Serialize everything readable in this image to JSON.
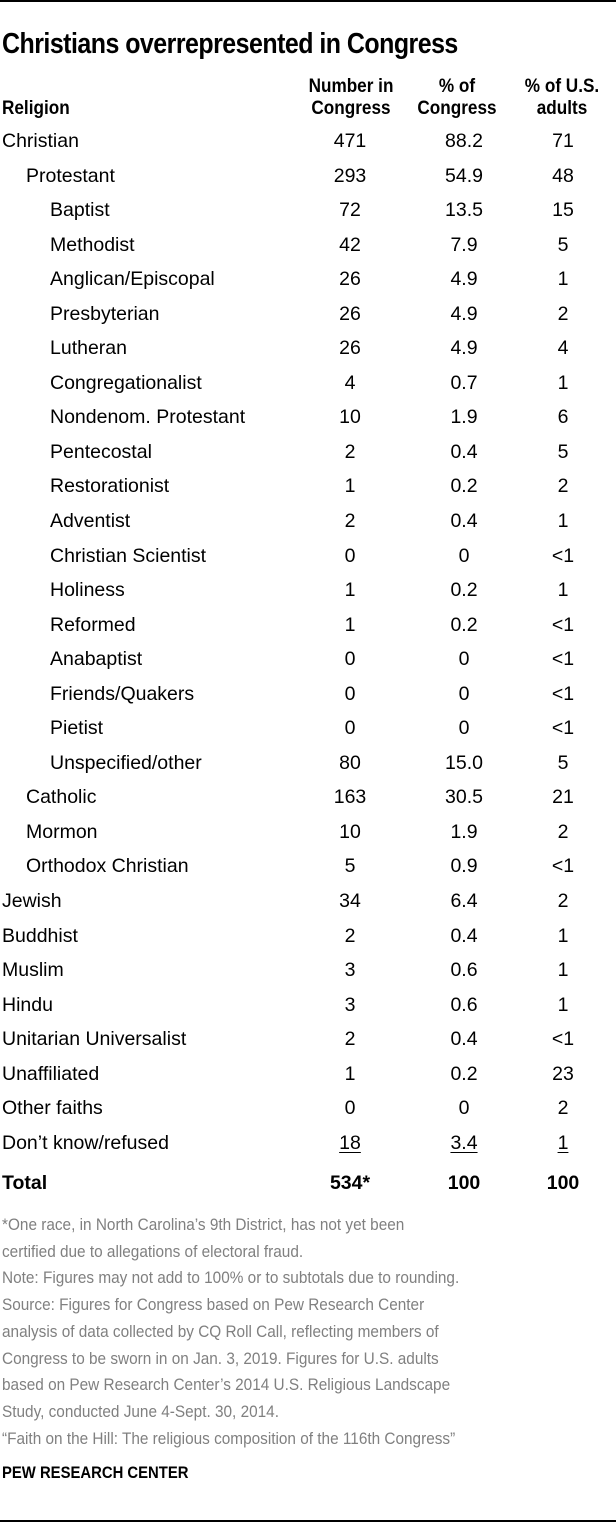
{
  "chart_data": {
    "type": "table",
    "title": "Christians overrepresented in Congress",
    "columns": [
      "Religion",
      "Number in Congress",
      "% of Congress",
      "% of U.S. adults"
    ],
    "column_headers": {
      "religion": "Religion",
      "number_line1": "Number in",
      "number_line2": "Congress",
      "pct_congress_line1": "% of",
      "pct_congress_line2": "Congress",
      "pct_us_line1": "% of U.S.",
      "pct_us_line2": "adults"
    },
    "rows": [
      {
        "religion": "Christian",
        "level": 0,
        "number": "471",
        "pct_congress": "88.2",
        "pct_us": "71"
      },
      {
        "religion": "Protestant",
        "level": 1,
        "number": "293",
        "pct_congress": "54.9",
        "pct_us": "48"
      },
      {
        "religion": "Baptist",
        "level": 2,
        "number": "72",
        "pct_congress": "13.5",
        "pct_us": "15"
      },
      {
        "religion": "Methodist",
        "level": 2,
        "number": "42",
        "pct_congress": "7.9",
        "pct_us": "5"
      },
      {
        "religion": "Anglican/Episcopal",
        "level": 2,
        "number": "26",
        "pct_congress": "4.9",
        "pct_us": "1"
      },
      {
        "religion": "Presbyterian",
        "level": 2,
        "number": "26",
        "pct_congress": "4.9",
        "pct_us": "2"
      },
      {
        "religion": "Lutheran",
        "level": 2,
        "number": "26",
        "pct_congress": "4.9",
        "pct_us": "4"
      },
      {
        "religion": "Congregationalist",
        "level": 2,
        "number": "4",
        "pct_congress": "0.7",
        "pct_us": "1"
      },
      {
        "religion": "Nondenom. Protestant",
        "level": 2,
        "number": "10",
        "pct_congress": "1.9",
        "pct_us": "6"
      },
      {
        "religion": "Pentecostal",
        "level": 2,
        "number": "2",
        "pct_congress": "0.4",
        "pct_us": "5"
      },
      {
        "religion": "Restorationist",
        "level": 2,
        "number": "1",
        "pct_congress": "0.2",
        "pct_us": "2"
      },
      {
        "religion": "Adventist",
        "level": 2,
        "number": "2",
        "pct_congress": "0.4",
        "pct_us": "1"
      },
      {
        "religion": "Christian Scientist",
        "level": 2,
        "number": "0",
        "pct_congress": "0",
        "pct_us": "<1"
      },
      {
        "religion": "Holiness",
        "level": 2,
        "number": "1",
        "pct_congress": "0.2",
        "pct_us": "1"
      },
      {
        "religion": "Reformed",
        "level": 2,
        "number": "1",
        "pct_congress": "0.2",
        "pct_us": "<1"
      },
      {
        "religion": "Anabaptist",
        "level": 2,
        "number": "0",
        "pct_congress": "0",
        "pct_us": "<1"
      },
      {
        "religion": "Friends/Quakers",
        "level": 2,
        "number": "0",
        "pct_congress": "0",
        "pct_us": "<1"
      },
      {
        "religion": "Pietist",
        "level": 2,
        "number": "0",
        "pct_congress": "0",
        "pct_us": "<1"
      },
      {
        "religion": "Unspecified/other",
        "level": 2,
        "number": "80",
        "pct_congress": "15.0",
        "pct_us": "5"
      },
      {
        "religion": "Catholic",
        "level": 1,
        "number": "163",
        "pct_congress": "30.5",
        "pct_us": "21"
      },
      {
        "religion": "Mormon",
        "level": 1,
        "number": "10",
        "pct_congress": "1.9",
        "pct_us": "2"
      },
      {
        "religion": "Orthodox Christian",
        "level": 1,
        "number": "5",
        "pct_congress": "0.9",
        "pct_us": "<1"
      },
      {
        "religion": "Jewish",
        "level": 0,
        "number": "34",
        "pct_congress": "6.4",
        "pct_us": "2"
      },
      {
        "religion": "Buddhist",
        "level": 0,
        "number": "2",
        "pct_congress": "0.4",
        "pct_us": "1"
      },
      {
        "religion": "Muslim",
        "level": 0,
        "number": "3",
        "pct_congress": "0.6",
        "pct_us": "1"
      },
      {
        "religion": "Hindu",
        "level": 0,
        "number": "3",
        "pct_congress": "0.6",
        "pct_us": "1"
      },
      {
        "religion": "Unitarian Universalist",
        "level": 0,
        "number": "2",
        "pct_congress": "0.4",
        "pct_us": "<1"
      },
      {
        "religion": "Unaffiliated",
        "level": 0,
        "number": "1",
        "pct_congress": "0.2",
        "pct_us": "23"
      },
      {
        "religion": "Other faiths",
        "level": 0,
        "number": "0",
        "pct_congress": "0",
        "pct_us": "2"
      },
      {
        "religion": "Don’t know/refused",
        "level": 0,
        "number": "18",
        "pct_congress": "3.4",
        "pct_us": "1",
        "underlined": true
      }
    ],
    "total": {
      "religion": "Total",
      "number": "534*",
      "pct_congress": "100",
      "pct_us": "100"
    }
  },
  "notes": [
    "*One race, in North Carolina’s 9th District, has not yet been",
    "certified due to allegations of electoral fraud.",
    "Note: Figures may not add to 100% or to subtotals due to rounding.",
    "Source: Figures for Congress based on Pew Research Center",
    "analysis of data collected by CQ Roll Call, reflecting members of",
    "Congress to be sworn in on Jan. 3, 2019. Figures for U.S. adults",
    "based on Pew Research Center’s 2014 U.S. Religious Landscape",
    "Study, conducted June 4-Sept. 30, 2014.",
    "“Faith on the Hill: The religious composition of the 116th Congress”"
  ],
  "brand": "PEW RESEARCH CENTER",
  "colors": {
    "text": "#000000",
    "notes": "#808080",
    "background": "#ffffff"
  }
}
